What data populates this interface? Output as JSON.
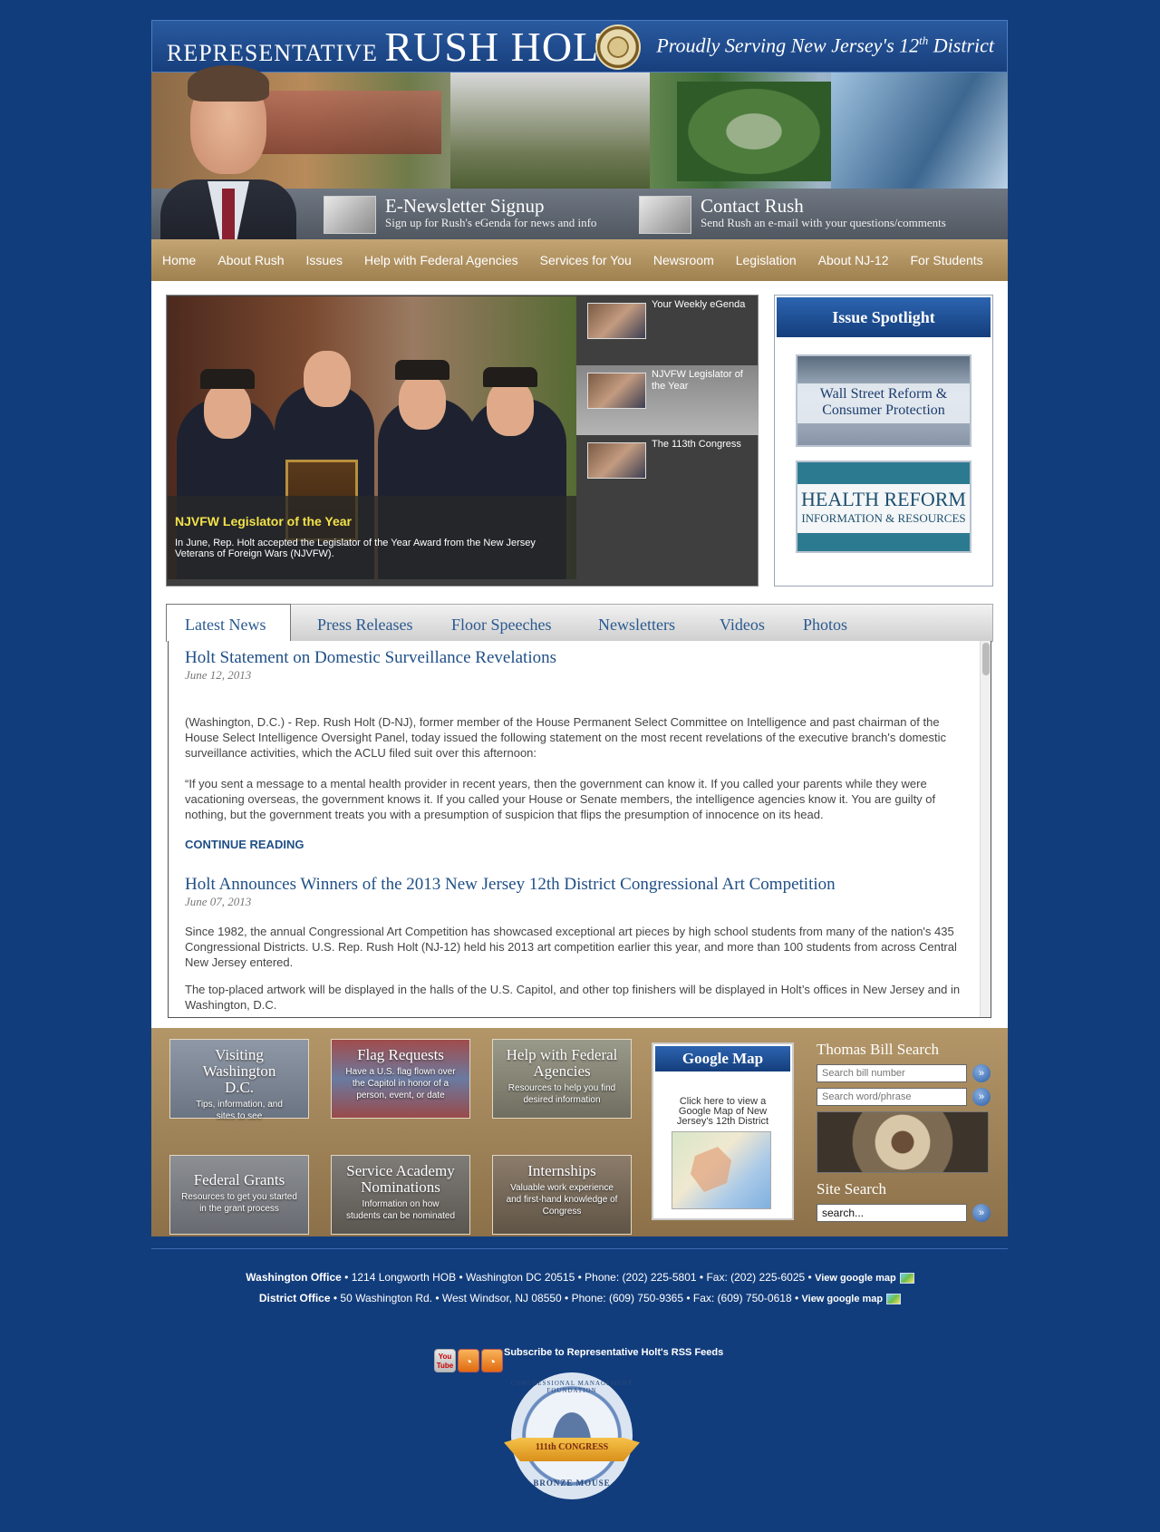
{
  "header": {
    "title_prefix": "Representative",
    "title_name": "Rush Holt",
    "tagline_pre": "Proudly Serving New Jersey's 12",
    "tagline_sup": "th",
    "tagline_post": " District"
  },
  "actions": [
    {
      "title": "E-Newsletter Signup",
      "subtitle": "Sign up for Rush's eGenda for news and info",
      "icon": "newsletter-icon"
    },
    {
      "title": "Contact Rush",
      "subtitle": "Send Rush an e-mail with your questions/comments",
      "icon": "keyboard-icon"
    }
  ],
  "nav": [
    "Home",
    "About Rush",
    "Issues",
    "Help with Federal Agencies",
    "Services for You",
    "Newsroom",
    "Legislation",
    "About NJ-12",
    "For Students"
  ],
  "slider": {
    "caption_title": "NJVFW Legislator of the Year",
    "caption_text": "In June, Rep. Holt accepted the Legislator of the Year Award from the New Jersey Veterans of Foreign Wars (NJVFW).",
    "thumbs": [
      "Your Weekly eGenda",
      "NJVFW Legislator of the Year",
      "The 113th Congress"
    ],
    "active_index": 1
  },
  "spotlight": {
    "title": "Issue Spotlight",
    "card1_line1": "Wall Street Reform &",
    "card1_line2": "Consumer Protection",
    "card2_line1": "HEALTH REFORM",
    "card2_line2": "INFORMATION & RESOURCES"
  },
  "tabs": [
    "Latest News",
    "Press Releases",
    "Floor Speeches",
    "Newsletters",
    "Videos",
    "Photos"
  ],
  "articles": [
    {
      "title": "Holt Statement on Domestic Surveillance Revelations",
      "date": "June 12, 2013",
      "p1": "(Washington, D.C.) - Rep. Rush Holt (D-NJ), former member of the House Permanent Select Committee on Intelligence and past chairman of the House Select Intelligence Oversight Panel, today issued the following statement on the most recent revelations of the executive branch's domestic surveillance activities, which the ACLU filed suit over this afternoon:",
      "p2": "“If you sent a message to a mental health provider in recent years, then the government can know it.  If you called your parents while they were vacationing overseas, the government knows it.  If you called your House or Senate members, the intelligence agencies know it.  You are guilty of nothing, but the government treats you with a presumption of suspicion that flips the presumption of innocence on its head.",
      "more": "CONTINUE READING"
    },
    {
      "title": "Holt Announces Winners of the 2013 New Jersey 12th District Congressional Art Competition",
      "date": "June 07, 2013",
      "p1": "Since 1982, the annual Congressional Art Competition has showcased exceptional art pieces by high school students from many of the nation's 435 Congressional Districts.  U.S. Rep. Rush Holt (NJ-12) held his 2013 art competition earlier this year, and more than 100 students from across Central New Jersey entered.",
      "p2": "The top-placed artwork will be displayed in the halls of the U.S. Capitol, and other top finishers will be displayed in Holt’s offices in New Jersey and in Washington, D.C."
    }
  ],
  "tiles": [
    {
      "title": "Visiting Washington D.C.",
      "sub": "Tips, information, and sites to see"
    },
    {
      "title": "Flag Requests",
      "sub": "Have a U.S. flag flown over the Capitol in honor of a person, event, or date"
    },
    {
      "title": "Help with Federal Agencies",
      "sub": "Resources to help you find desired information"
    },
    {
      "title": "Federal Grants",
      "sub": "Resources to get you started in the grant process"
    },
    {
      "title": "Service Academy Nominations",
      "sub": "Information on how students can be nominated"
    },
    {
      "title": "Internships",
      "sub": "Valuable work experience and first-hand knowledge of Congress"
    }
  ],
  "gmap": {
    "title": "Google Map",
    "text": "Click here to view a Google Map of New Jersey's 12th District"
  },
  "search": {
    "thomas_label": "Thomas Bill Search",
    "bill_placeholder": "Search bill number",
    "word_placeholder": "Search word/phrase",
    "site_label": "Site Search",
    "site_value": "search...",
    "go": "»"
  },
  "footer": {
    "dc_label": "Washington Office",
    "dc_text": " • 1214 Longworth HOB • Washington DC 20515 • Phone: (202) 225-5801 • Fax: (202) 225-6025 • ",
    "district_label": "District Office",
    "district_text": " • 50 Washington Rd. • West Windsor, NJ 08550 • Phone: (609) 750-9365 • Fax: (609) 750-0618 • ",
    "map_link": "View google map",
    "rss_text": "Subscribe to Representative Holt's RSS Feeds",
    "youtube": "You Tube",
    "badge_top": "CONGRESSIONAL MANAGEMENT FOUNDATION",
    "badge_ribbon": "111th CONGRESS",
    "badge_bottom": "BRONZE MOUSE"
  }
}
